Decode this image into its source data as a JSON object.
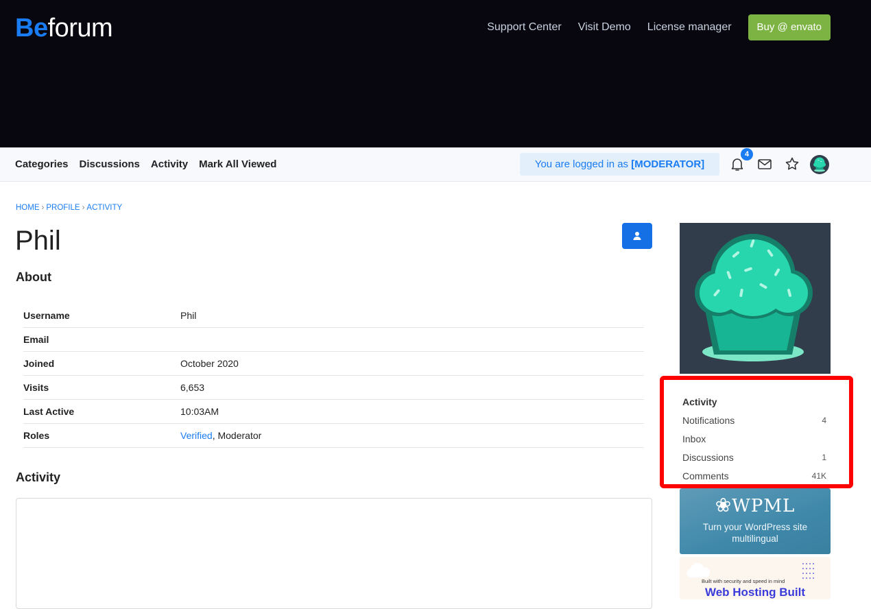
{
  "brand": {
    "logo_prefix": "Be",
    "logo_suffix": "forum"
  },
  "top_nav": {
    "links": [
      "Support Center",
      "Visit Demo",
      "License manager"
    ],
    "cta": "Buy @ envato"
  },
  "menu": {
    "items": [
      "Categories",
      "Discussions",
      "Activity",
      "Mark All Viewed"
    ],
    "logged_in_prefix": "You are logged in as ",
    "logged_in_role": "[MODERATOR]",
    "notification_count": "4",
    "icons": [
      "bell-icon",
      "mail-icon",
      "star-icon",
      "avatar"
    ]
  },
  "breadcrumb": {
    "home": "HOME",
    "profile": "PROFILE",
    "current": "ACTIVITY",
    "separator": "›"
  },
  "profile": {
    "name": "Phil",
    "about_heading": "About",
    "activity_heading": "Activity",
    "fields": {
      "username_label": "Username",
      "username": "Phil",
      "email_label": "Email",
      "email": "",
      "joined_label": "Joined",
      "joined": "October 2020",
      "visits_label": "Visits",
      "visits": "6,653",
      "last_active_label": "Last Active",
      "last_active": "10:03AM",
      "roles_label": "Roles",
      "role_link": "Verified",
      "role_rest": ", Moderator"
    }
  },
  "sidebar": {
    "heading": "Activity",
    "items": [
      {
        "label": "Notifications",
        "count": "4"
      },
      {
        "label": "Inbox",
        "count": ""
      },
      {
        "label": "Discussions",
        "count": "1"
      },
      {
        "label": "Comments",
        "count": "41K"
      }
    ]
  },
  "ads": {
    "wpml_logo": "WPML",
    "wpml_tagline": "Turn your WordPress site multilingual",
    "hosting_small": "Built with security and speed in mind",
    "hosting_big": "Web Hosting Built"
  },
  "colors": {
    "accent": "#1a7cf2",
    "cta_green": "#7cb342",
    "header_bg": "#08070f",
    "highlight_red": "#ff0000"
  }
}
